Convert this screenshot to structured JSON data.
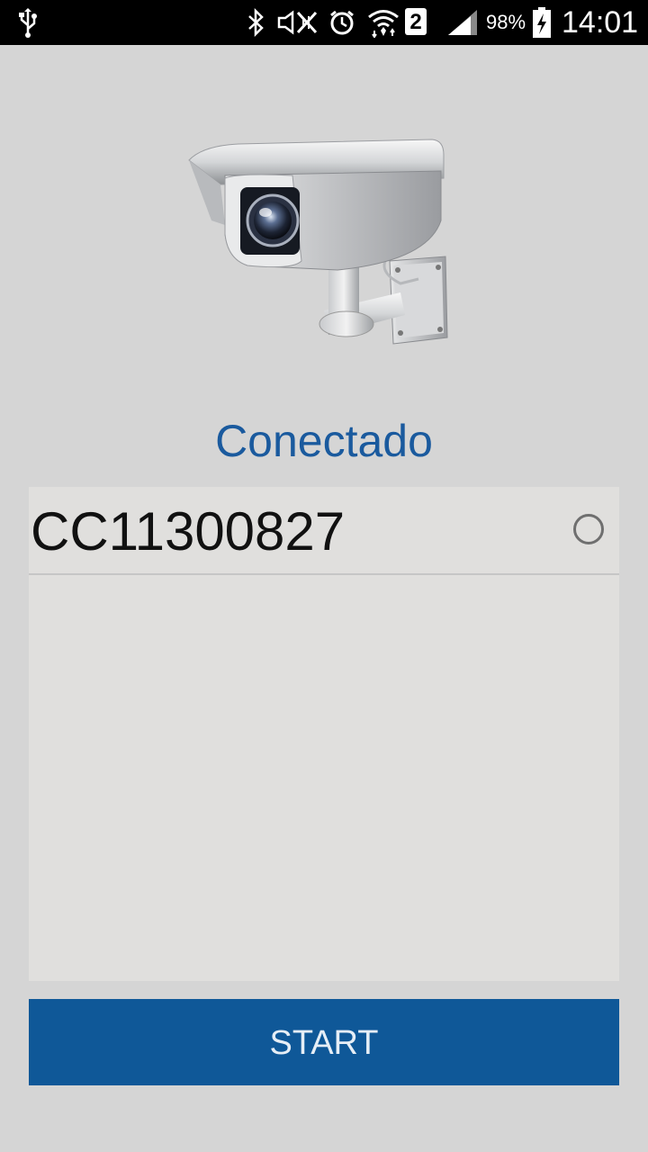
{
  "status_bar": {
    "battery_percent": "98%",
    "time": "14:01",
    "sim_slot": "2",
    "icons": [
      "usb-icon",
      "bluetooth-icon",
      "nfc-mute-icon",
      "alarm-icon",
      "wifi-icon",
      "sim-icon",
      "signal-icon",
      "battery-charging-icon"
    ]
  },
  "main": {
    "logo": "security-camera-icon",
    "status_label": "Conectado",
    "devices": [
      {
        "name": "CC11300827",
        "selected": false
      }
    ],
    "start_label": "START"
  },
  "colors": {
    "status_text": "#1a5a9e",
    "button_bg": "#0f5898",
    "background": "#d5d5d5",
    "list_bg": "#e0dfdd"
  }
}
